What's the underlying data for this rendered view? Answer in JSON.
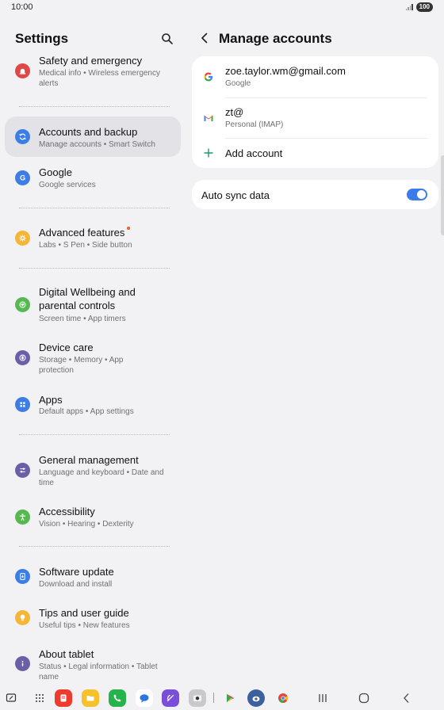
{
  "status_bar": {
    "time": "10:00",
    "battery": "100"
  },
  "left": {
    "title": "Settings",
    "items": [
      {
        "title": "Safety and emergency",
        "subtitle": "Medical info  •  Wireless emergency alerts",
        "color": "#e04747",
        "icon": "siren-icon"
      },
      {
        "title": "Accounts and backup",
        "subtitle": "Manage accounts  •  Smart Switch",
        "color": "#3d7ee6",
        "icon": "sync-icon",
        "selected": true
      },
      {
        "title": "Google",
        "subtitle": "Google services",
        "color": "#3d7ee6",
        "icon": "google-g-icon"
      },
      {
        "title": "Advanced features",
        "subtitle": "Labs  •  S Pen  •  Side button",
        "color": "#f7b535",
        "icon": "puzzle-gear-icon",
        "badge": true
      },
      {
        "title": "Digital Wellbeing and parental controls",
        "subtitle": "Screen time  •  App timers",
        "color": "#56b84f",
        "icon": "wellbeing-heart-icon"
      },
      {
        "title": "Device care",
        "subtitle": "Storage  •  Memory  •  App protection",
        "color": "#6b5fa8",
        "icon": "device-care-icon"
      },
      {
        "title": "Apps",
        "subtitle": "Default apps  •  App settings",
        "color": "#3d7ee6",
        "icon": "apps-grid-icon"
      },
      {
        "title": "General management",
        "subtitle": "Language and keyboard  •  Date and time",
        "color": "#6b5fa8",
        "icon": "sliders-icon"
      },
      {
        "title": "Accessibility",
        "subtitle": "Vision  •  Hearing  •  Dexterity",
        "color": "#56b84f",
        "icon": "accessibility-person-icon"
      },
      {
        "title": "Software update",
        "subtitle": "Download and install",
        "color": "#3d7ee6",
        "icon": "software-update-icon"
      },
      {
        "title": "Tips and user guide",
        "subtitle": "Useful tips  •  New features",
        "color": "#f7b535",
        "icon": "lightbulb-icon"
      },
      {
        "title": "About tablet",
        "subtitle": "Status  •  Legal information  •  Tablet name",
        "color": "#6b5fa8",
        "icon": "info-icon"
      }
    ]
  },
  "right": {
    "title": "Manage accounts",
    "accounts": [
      {
        "title": "zoe.taylor.wm@gmail.com",
        "subtitle": "Google",
        "icon": "google-logo-icon"
      },
      {
        "title": "zt@",
        "subtitle": "Personal (IMAP)",
        "icon": "gmail-logo-icon"
      }
    ],
    "add_account_label": "Add account",
    "auto_sync_label": "Auto sync data",
    "auto_sync_on": true,
    "accent_color": "#3b7bea"
  },
  "taskbar": {
    "apps": [
      {
        "name": "samsung-notes-icon",
        "color": "#ef3b2d"
      },
      {
        "name": "my-files-icon",
        "color": "#f6c12a"
      },
      {
        "name": "phone-icon",
        "color": "#27b34b"
      },
      {
        "name": "messages-icon",
        "color": "#2b74e2"
      },
      {
        "name": "galaxy-store-icon",
        "color": "#7b4ddb"
      },
      {
        "name": "camera-icon",
        "color": "#c9c9cc"
      },
      {
        "name": "play-store-icon",
        "color": "#ffffff"
      },
      {
        "name": "bixby-icon",
        "color": "#3c5f9e"
      },
      {
        "name": "chrome-icon",
        "color": "#ffffff"
      }
    ]
  }
}
